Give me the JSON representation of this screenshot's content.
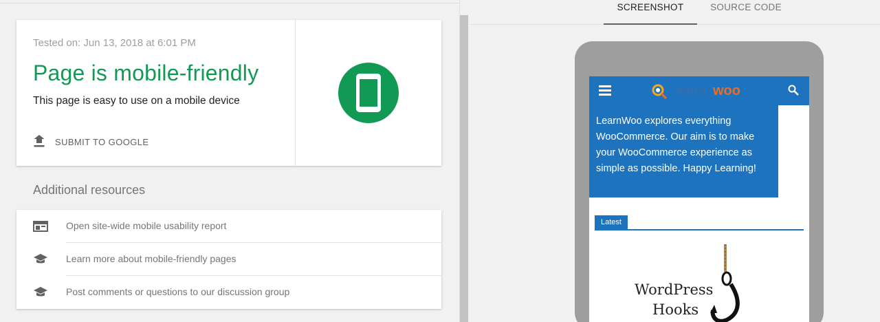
{
  "result": {
    "tested_on": "Tested on: Jun 13, 2018 at 6:01 PM",
    "verdict": "Page is mobile-friendly",
    "description": "This page is easy to use on a mobile device",
    "submit_label": "SUBMIT TO GOOGLE",
    "badge_icon": "smartphone-icon",
    "accent_color": "#129a55"
  },
  "resources": {
    "title": "Additional resources",
    "items": [
      {
        "icon": "web-page-icon",
        "label": "Open site-wide mobile usability report"
      },
      {
        "icon": "school-cap-icon",
        "label": "Learn more about mobile-friendly pages"
      },
      {
        "icon": "school-cap-icon",
        "label": "Post comments or questions to our discussion group"
      }
    ]
  },
  "tabs": [
    {
      "label": "SCREENSHOT",
      "active": true
    },
    {
      "label": "SOURCE CODE",
      "active": false
    }
  ],
  "preview": {
    "logo_learn": "learn",
    "logo_woo": "woo",
    "intro_text": "LearnWoo explores everything WooCommerce. Our aim is to make your WooCommerce experience as simple as possible. Happy Learning!",
    "latest_label": "Latest",
    "art_line1": "WordPress",
    "art_line2": "Hooks",
    "brand_color": "#1e73be"
  }
}
